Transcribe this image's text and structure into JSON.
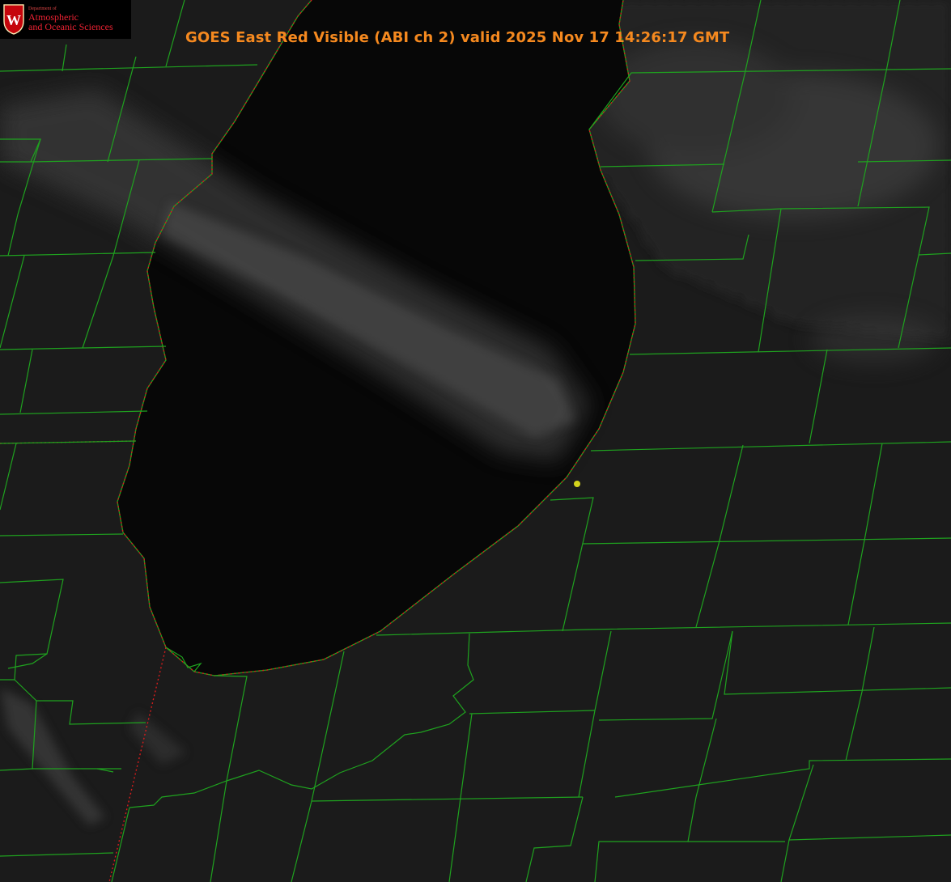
{
  "title": "GOES East Red Visible (ABI ch 2) valid 2025 Nov 17 14:26:17 GMT",
  "logo": {
    "dept": "Department of",
    "line1": "Atmospheric",
    "line2": "and Oceanic Sciences",
    "crest_letter": "W"
  },
  "colors": {
    "county_lines": "#1fa21f",
    "state_line": "#d41c1c",
    "title": "#f5891f",
    "marker": "#d4d41c",
    "logo": "#c5050c"
  }
}
